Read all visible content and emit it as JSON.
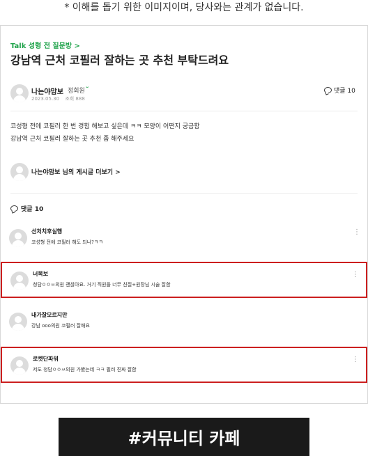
{
  "disclaimer": "* 이해를 돕기 위한 이미지이며, 당사와는 관계가 없습니다.",
  "post": {
    "cafe_link": "Talk 성형 전 질문방 >",
    "title": "강남역 근처 코필러 잘하는 곳 추천 부탁드려요",
    "author": "나는야맘보",
    "member_level": "정회원",
    "badge": "ᵕ",
    "date": "2023.05.30",
    "views": "조회 888",
    "comment_count": "댓글 10",
    "body_line1": "코성형 전에 코필러 한 번 경험 해보고 싶은데 ㅋㅋ 모양이 어떤지 궁금함",
    "body_line2": "강남역 근처 코필러 잘하는 곳 추천 좀 해주세요",
    "more_posts": "나는야맘보 님의 게시글 더보기 >"
  },
  "comments_header": "댓글 10",
  "comments": [
    {
      "author": "선처치후실행",
      "text": "코성형 전에 코필러 해도 되나?ㅋㅋ",
      "highlighted": false
    },
    {
      "author": "너목보",
      "text": "청담ㅇㅇㅆ의원 괜찮아요. 거기 직원들 너무 친절+원장님 시술 잘함",
      "highlighted": true
    },
    {
      "author": "내가잘모르지만",
      "text": "강남 ooo의원 코필러 잘해요",
      "highlighted": false
    },
    {
      "author": "로켓단파워",
      "text": "저도 청담ㅇㅇㅆ의원 가봤는데 ㅋㅋ 필러 진짜 잘함",
      "highlighted": true
    }
  ],
  "kebab_icon": "more-vertical-icon",
  "footer_tag": "#커뮤니티 카페",
  "colors": {
    "accent_green": "#1fa34a",
    "highlight_red": "#cc1f1f",
    "footer_bg": "#1a1a1a"
  }
}
